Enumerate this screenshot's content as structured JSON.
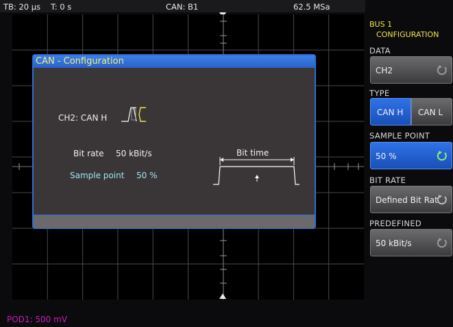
{
  "status_bar": {
    "timebase": "TB: 20 µs",
    "trigger": "T: 0 s",
    "source": "CAN: B1",
    "sample_rate": "62.5 MSa"
  },
  "channel_label": "POD1: 500 mV",
  "dialog": {
    "title": "CAN - Configuration",
    "signal_label": "CH2: CAN H",
    "bit_rate_label": "Bit rate",
    "bit_rate_value": "50 kBit/s",
    "sample_point_label": "Sample point",
    "sample_point_value": "50 %",
    "bit_time_label": "Bit time"
  },
  "sidebar": {
    "header_line1": "BUS 1",
    "header_line2": "CONFIGURATION",
    "data_label": "DATA",
    "data_value": "CH2",
    "type_label": "TYPE",
    "type_options": [
      "CAN H",
      "CAN L"
    ],
    "type_selected": "CAN H",
    "sample_point_label": "SAMPLE POINT",
    "sample_point_value": "50 %",
    "bit_rate_label": "BIT RATE",
    "bit_rate_value": "Defined Bit Rat",
    "predefined_label": "PREDEFINED",
    "predefined_value": "50 kBit/s"
  },
  "colors": {
    "accent_blue": "#2f6ed6",
    "title_yellow": "#f5f075",
    "channel_magenta": "#c81eb4",
    "waveform_yellow": "#f0e44a"
  }
}
